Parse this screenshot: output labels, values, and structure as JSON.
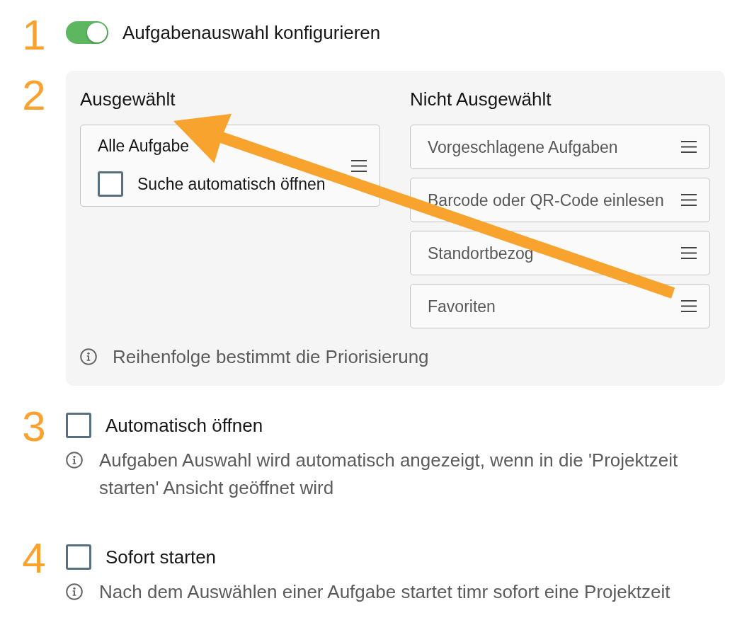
{
  "sections": [
    {
      "kind": "toggle",
      "step": "1",
      "label": "Aufgabenauswahl konfigurieren",
      "on": true
    },
    {
      "kind": "lists",
      "step": "2",
      "lists": [
        {
          "title": "Ausgewählt",
          "items": [
            {
              "label": "Alle Aufgabe",
              "active": true,
              "option": {
                "label": "Suche automatisch öffnen",
                "checked": false
              }
            }
          ]
        },
        {
          "title": "Nicht Ausgewählt",
          "items": [
            {
              "label": "Vorgeschlagene Aufgaben",
              "active": false
            },
            {
              "label": "Barcode oder QR-Code einlesen",
              "active": false
            },
            {
              "label": "Standortbezog",
              "active": false
            },
            {
              "label": "Favoriten",
              "active": false
            }
          ]
        }
      ],
      "hint": "Reihenfolge bestimmt die Priorisierung"
    },
    {
      "kind": "checkbox",
      "step": "3",
      "label": "Automatisch öffnen",
      "checked": false,
      "hint": "Aufgaben Auswahl wird automatisch angezeigt, wenn in die 'Projektzeit starten' Ansicht geöffnet wird"
    },
    {
      "kind": "checkbox",
      "step": "4",
      "label": "Sofort starten",
      "checked": false,
      "hint": "Nach dem Auswählen einer Aufgabe startet timr sofort eine Projektzeit"
    }
  ]
}
